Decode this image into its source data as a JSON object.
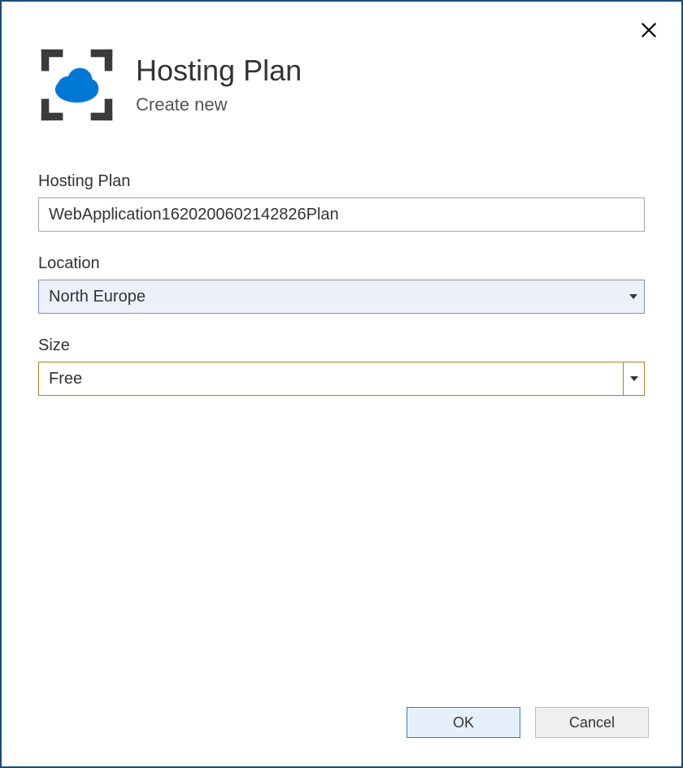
{
  "dialog": {
    "title": "Hosting Plan",
    "subtitle": "Create new"
  },
  "form": {
    "hostingPlan": {
      "label": "Hosting Plan",
      "value": "WebApplication1620200602142826Plan"
    },
    "location": {
      "label": "Location",
      "value": "North Europe"
    },
    "size": {
      "label": "Size",
      "value": "Free"
    }
  },
  "footer": {
    "ok": "OK",
    "cancel": "Cancel"
  },
  "colors": {
    "dialogBorder": "#1a4d7a",
    "azureBlue": "#0078d4",
    "iconGray": "#3b3b3b",
    "locationBorder": "#7a93b0",
    "locationBg": "#ecf1f9",
    "sizeBorder": "#a8842a",
    "okBg": "#e6f0fb",
    "okBorder": "#3a77b7",
    "cancelBg": "#efefef",
    "cancelBorder": "#bfbfbf"
  }
}
